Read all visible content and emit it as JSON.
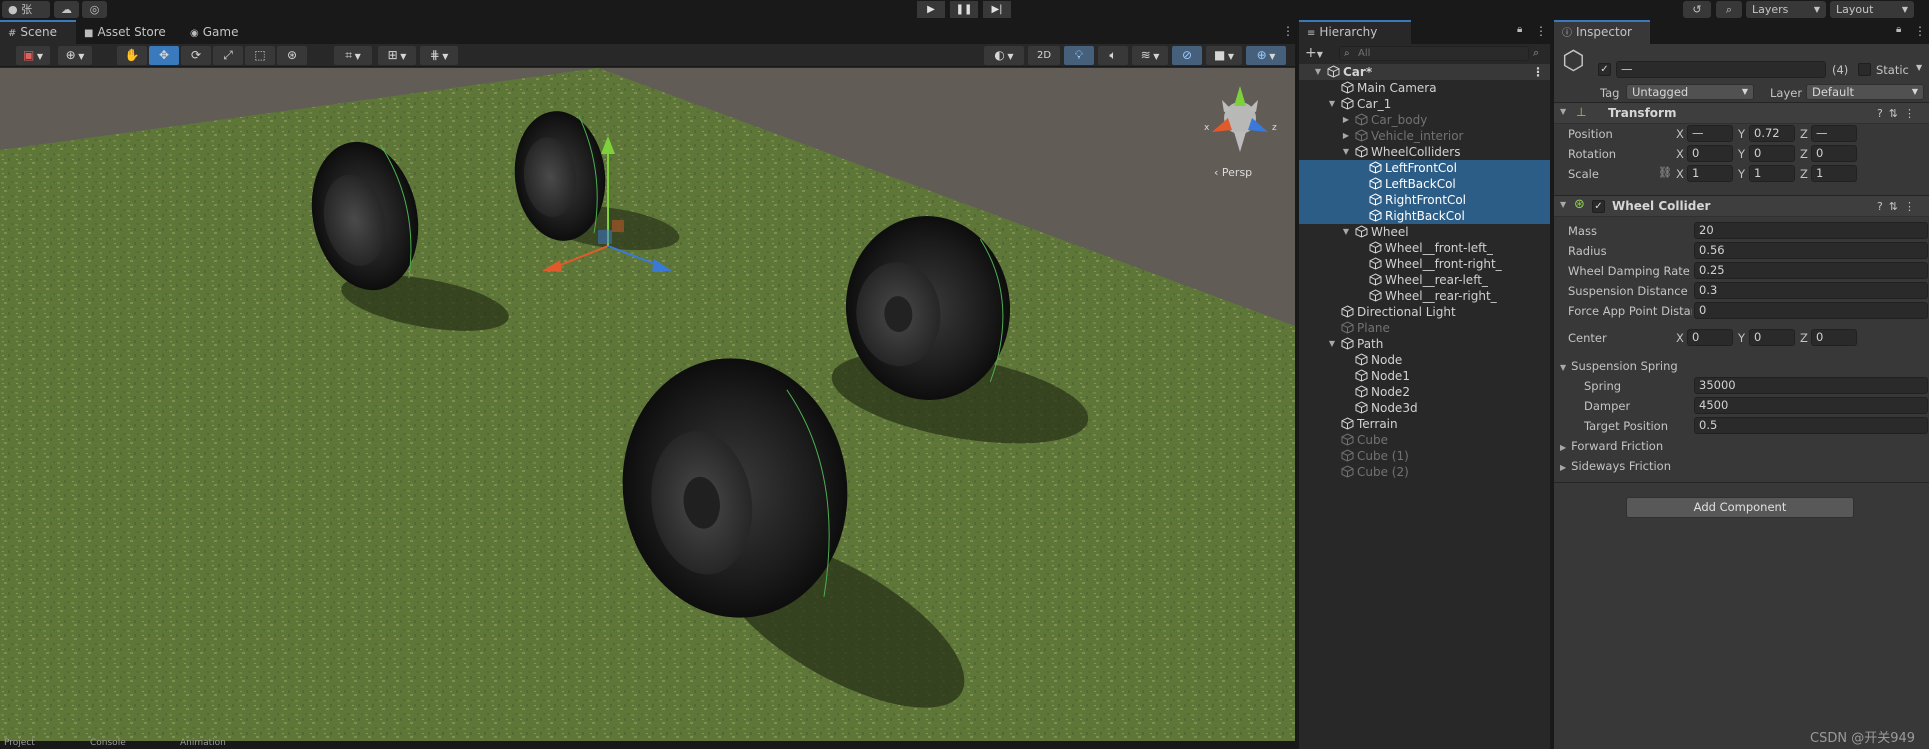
{
  "toolbar": {
    "account_label": "张",
    "layers_label": "Layers",
    "layout_label": "Layout"
  },
  "scene_panel": {
    "tabs": [
      {
        "label": "Scene",
        "icon": "grid-icon"
      },
      {
        "label": "Asset Store",
        "icon": "bag-icon"
      },
      {
        "label": "Game",
        "icon": "gamepad-icon"
      }
    ],
    "mode_2d_label": "2D",
    "gizmo_label": "Persp",
    "gizmo_axes": {
      "x": "x",
      "z": "z"
    },
    "bottom_tabs": [
      {
        "label": "Project"
      },
      {
        "label": "Console"
      },
      {
        "label": "Animation"
      }
    ]
  },
  "hierarchy": {
    "title": "Hierarchy",
    "search_placeholder": "All",
    "items": [
      {
        "label": "Car*",
        "depth": 0,
        "expanded": true,
        "state": "root"
      },
      {
        "label": "Main Camera",
        "depth": 1,
        "state": "normal"
      },
      {
        "label": "Car_1",
        "depth": 1,
        "expanded": true,
        "state": "normal"
      },
      {
        "label": "Car_body",
        "depth": 2,
        "collapsed": true,
        "state": "dim"
      },
      {
        "label": "Vehicle_interior",
        "depth": 2,
        "collapsed": true,
        "state": "dim"
      },
      {
        "label": "WheelColliders",
        "depth": 2,
        "expanded": true,
        "state": "normal"
      },
      {
        "label": "LeftFrontCol",
        "depth": 3,
        "state": "selected"
      },
      {
        "label": "LeftBackCol",
        "depth": 3,
        "state": "selected"
      },
      {
        "label": "RightFrontCol",
        "depth": 3,
        "state": "selected"
      },
      {
        "label": "RightBackCol",
        "depth": 3,
        "state": "selected"
      },
      {
        "label": "Wheel",
        "depth": 2,
        "expanded": true,
        "state": "normal"
      },
      {
        "label": "Wheel__front-left_",
        "depth": 3,
        "state": "normal"
      },
      {
        "label": "Wheel__front-right_",
        "depth": 3,
        "state": "normal"
      },
      {
        "label": "Wheel__rear-left_",
        "depth": 3,
        "state": "normal"
      },
      {
        "label": "Wheel__rear-right_",
        "depth": 3,
        "state": "normal"
      },
      {
        "label": "Directional Light",
        "depth": 1,
        "state": "normal"
      },
      {
        "label": "Plane",
        "depth": 1,
        "state": "dim"
      },
      {
        "label": "Path",
        "depth": 1,
        "expanded": true,
        "state": "normal"
      },
      {
        "label": "Node",
        "depth": 2,
        "state": "normal"
      },
      {
        "label": "Node1",
        "depth": 2,
        "state": "normal"
      },
      {
        "label": "Node2",
        "depth": 2,
        "state": "normal"
      },
      {
        "label": "Node3d",
        "depth": 2,
        "state": "normal"
      },
      {
        "label": "Terrain",
        "depth": 1,
        "state": "normal"
      },
      {
        "label": "Cube",
        "depth": 1,
        "state": "dim"
      },
      {
        "label": "Cube (1)",
        "depth": 1,
        "state": "dim"
      },
      {
        "label": "Cube (2)",
        "depth": 1,
        "state": "dim"
      }
    ]
  },
  "inspector": {
    "title": "Inspector",
    "object_name": "—",
    "selection_count": "(4)",
    "static_label": "Static",
    "tag_label": "Tag",
    "tag_value": "Untagged",
    "layer_label": "Layer",
    "layer_value": "Default",
    "transform": {
      "title": "Transform",
      "position_label": "Position",
      "rotation_label": "Rotation",
      "scale_label": "Scale",
      "axis_x": "X",
      "axis_y": "Y",
      "axis_z": "Z",
      "position": {
        "x": "—",
        "y": "0.72",
        "z": "—"
      },
      "rotation": {
        "x": "0",
        "y": "0",
        "z": "0"
      },
      "scale": {
        "x": "1",
        "y": "1",
        "z": "1"
      }
    },
    "wheel_collider": {
      "title": "Wheel Collider",
      "mass_label": "Mass",
      "mass": "20",
      "radius_label": "Radius",
      "radius": "0.56",
      "damping_label": "Wheel Damping Rate",
      "damping": "0.25",
      "suspension_distance_label": "Suspension Distance",
      "suspension_distance": "0.3",
      "force_app_label": "Force App Point Distar",
      "force_app": "0",
      "center_label": "Center",
      "center": {
        "x": "0",
        "y": "0",
        "z": "0"
      },
      "suspension_spring_label": "Suspension Spring",
      "spring_label": "Spring",
      "spring": "35000",
      "damper_label": "Damper",
      "damper": "4500",
      "target_position_label": "Target Position",
      "target_position": "0.5",
      "forward_friction_label": "Forward Friction",
      "sideways_friction_label": "Sideways Friction"
    },
    "add_component_label": "Add Component"
  },
  "watermark": "CSDN @开关949",
  "colors": {
    "selection": "#2c5d87",
    "accent": "#3a79bb",
    "grass": "#66823e",
    "ground": "#6b6560"
  }
}
